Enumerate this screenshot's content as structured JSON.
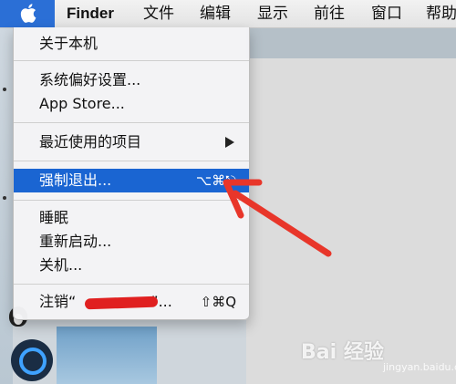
{
  "menubar": {
    "apple_icon": "apple-logo-icon",
    "items": [
      "Finder",
      "文件",
      "编辑",
      "显示",
      "前往",
      "窗口",
      "帮助"
    ]
  },
  "apple_menu": {
    "items": [
      {
        "label": "关于本机"
      },
      {
        "label": "系统偏好设置..."
      },
      {
        "label": "App Store..."
      },
      {
        "label": "最近使用的项目",
        "submenu": true
      },
      {
        "label": "强制退出...",
        "shortcut": "⌥⌘⎋",
        "highlighted": true
      },
      {
        "label": "睡眠"
      },
      {
        "label": "重新启动..."
      },
      {
        "label": "关机..."
      },
      {
        "label": "注销“",
        "label_suffix": "”...",
        "shortcut": "⇧⌘Q"
      }
    ]
  },
  "annotation": {
    "color": "#e8362a"
  },
  "colors": {
    "highlight": "#1a65d2",
    "menu_bg": "#f4f4f6"
  },
  "watermark": {
    "text": "Bai 经验",
    "sub": "jingyan.baidu.com"
  }
}
